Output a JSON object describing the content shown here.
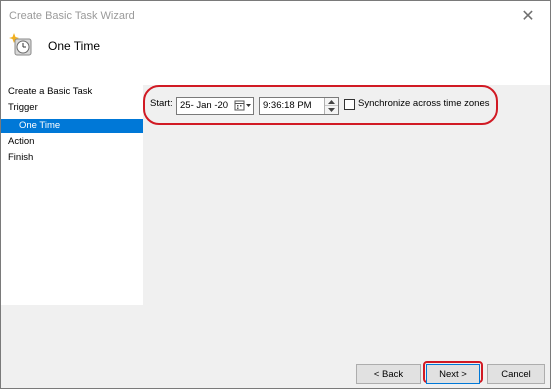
{
  "window": {
    "title": "Create Basic Task Wizard",
    "close_glyph": "✕"
  },
  "header": {
    "title": "One Time",
    "icon": "clock-sparkle-icon"
  },
  "sidebar": {
    "items": [
      {
        "label": "Create a Basic Task",
        "selected": false
      },
      {
        "label": "Trigger",
        "selected": false
      },
      {
        "label": "One Time",
        "selected": true
      },
      {
        "label": "Action",
        "selected": false
      },
      {
        "label": "Finish",
        "selected": false
      }
    ]
  },
  "trigger": {
    "start_label": "Start:",
    "date_value": "25- Jan -20",
    "time_value": "9:36:18 PM",
    "sync_label": "Synchronize across time zones",
    "sync_checked": false
  },
  "buttons": {
    "back": "< Back",
    "next": "Next >",
    "cancel": "Cancel"
  },
  "colors": {
    "selection": "#0078d7",
    "annotation": "#d11a24"
  }
}
